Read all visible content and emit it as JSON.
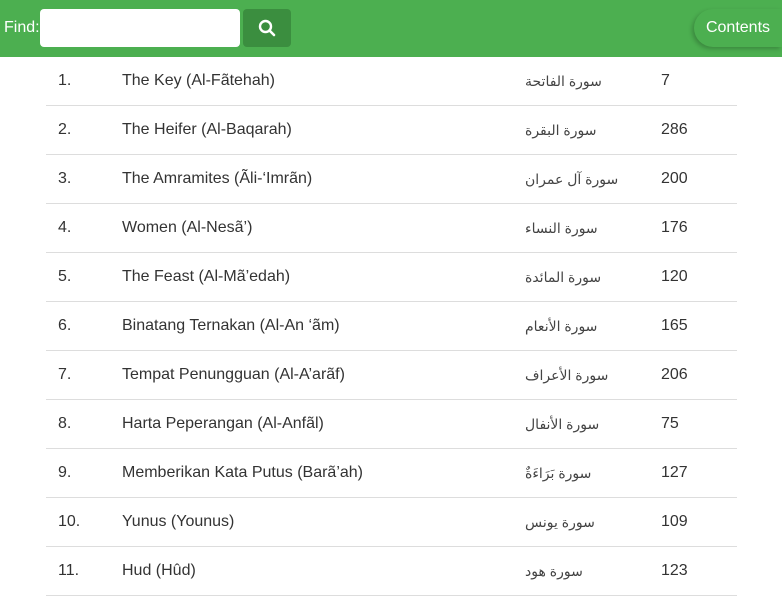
{
  "header": {
    "find_label": "Find:",
    "search_placeholder": "",
    "search_value": "",
    "search_icon": "search-icon",
    "contents_label": "Contents",
    "bar_color": "#4caf50",
    "button_color": "#3b8e3f"
  },
  "surahs": [
    {
      "num": "1.",
      "name": "The Key (Al-Fãtehah)",
      "arabic": "سورة الفاتحة",
      "verses": "7"
    },
    {
      "num": "2.",
      "name": "The Heifer (Al-Baqarah)",
      "arabic": "سورة البقرة",
      "verses": "286"
    },
    {
      "num": "3.",
      "name": "The Amramites (Ãli-‘Imrãn)",
      "arabic": "سورة آل عمران",
      "verses": "200"
    },
    {
      "num": "4.",
      "name": "Women (Al-Nesã’)",
      "arabic": "سورة النساء",
      "verses": "176"
    },
    {
      "num": "5.",
      "name": "The Feast (Al-Mã’edah)",
      "arabic": "سورة المائدة",
      "verses": "120"
    },
    {
      "num": "6.",
      "name": "Binatang Ternakan (Al-An ‘ãm)",
      "arabic": "سورة الأنعام",
      "verses": "165"
    },
    {
      "num": "7.",
      "name": "Tempat Penungguan (Al-A’arãf)",
      "arabic": "سورة الأعراف",
      "verses": "206"
    },
    {
      "num": "8.",
      "name": "Harta Peperangan (Al-Anfãl)",
      "arabic": "سورة الأنفال",
      "verses": "75"
    },
    {
      "num": "9.",
      "name": "Memberikan Kata Putus (Barã’ah)",
      "arabic": "سورة بَرَاءَةٌ",
      "verses": "127"
    },
    {
      "num": "10.",
      "name": "Yunus (Younus)",
      "arabic": "سورة يونس",
      "verses": "109"
    },
    {
      "num": "11.",
      "name": "Hud (Hûd)",
      "arabic": "سورة هود",
      "verses": "123"
    }
  ]
}
